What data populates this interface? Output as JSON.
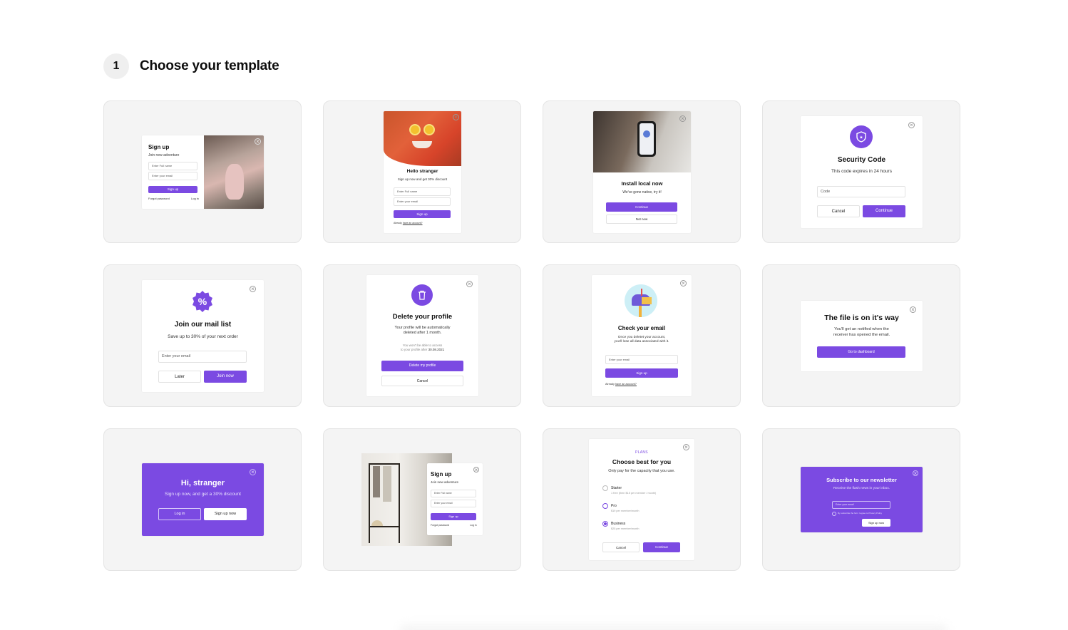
{
  "step": {
    "number": "1",
    "title": "Choose your template"
  },
  "colors": {
    "accent": "#7b4ae2",
    "card_bg": "#f4f4f4"
  },
  "t1": {
    "title": "Sign up",
    "subtitle": "Join new adventure",
    "name_ph": "Enter Full name",
    "email_ph": "Enter your email",
    "btn": "Sign up",
    "forgot": "Forgot password",
    "login": "Log in"
  },
  "t2": {
    "title": "Hello stranger",
    "subtitle": "Sign up now and get 30% discount",
    "name_ph": "Enter Full name",
    "email_ph": "Enter your email",
    "btn": "Sign up",
    "already": "Already",
    "have_account": "have an account?"
  },
  "t3": {
    "title": "Install local now",
    "subtitle": "We've gone native, try it!",
    "btn_primary": "Continue",
    "btn_secondary": "Not now"
  },
  "t4": {
    "title": "Security Code",
    "subtitle": "This code expires in 24 hours",
    "code_ph": "Code",
    "btn_cancel": "Cancel",
    "btn_continue": "Continue"
  },
  "t5": {
    "title": "Join our mail list",
    "subtitle": "Save up to 30% of your next order",
    "email_ph": "Enter your email",
    "btn_later": "Later",
    "btn_join": "Join now"
  },
  "t6": {
    "title": "Delete your profile",
    "line1": "Your profile will be automatically",
    "line2": "deleted after 1 month.",
    "note1": "You won't be able to access",
    "note2": "to your profile after",
    "date": "30.08.2021",
    "btn_delete": "Delete my profile",
    "btn_cancel": "Cancel"
  },
  "t7": {
    "title": "Check your email",
    "line1": "Once you deletet your account,",
    "line2": "you'll lose all data associated with it.",
    "email_ph": "Enter your email",
    "btn": "Sign up",
    "already": "Already",
    "have_account": "have an account?"
  },
  "t8": {
    "title": "The file is on it's way",
    "line1": "You'll get an notified when the",
    "line2": "receiver has opened the email.",
    "btn": "Go to dashboard"
  },
  "t9": {
    "title": "Hi, stranger",
    "subtitle": "Sign up now, and get a 30% discount",
    "btn_login": "Log in",
    "btn_signup": "Sign up now"
  },
  "t10": {
    "title": "Sign up",
    "subtitle": "Join new adventure",
    "name_ph": "Enter Full name",
    "email_ph": "Enter your email",
    "btn": "Sign up",
    "forgot": "Forgot password",
    "login": "Log in"
  },
  "t11": {
    "eyebrow": "PLANS",
    "title": "Choose best for you",
    "subtitle": "Only pay for the capacity that you use.",
    "plans": [
      {
        "name": "Starter",
        "desc": "1 free (then $15 per member / month)"
      },
      {
        "name": "Pro",
        "desc": "$19 per member/month"
      },
      {
        "name": "Business",
        "desc": "$25 per member/month"
      }
    ],
    "btn_cancel": "Cancel",
    "btn_continue": "Continue"
  },
  "t12": {
    "title": "Subscribe to our newsletter",
    "subtitle": "Receive the flash news in your inbox.",
    "email_ph": "Enter your email",
    "consent": "By subscribe the form I agree to Privacy Policy",
    "btn": "Sign up now"
  }
}
